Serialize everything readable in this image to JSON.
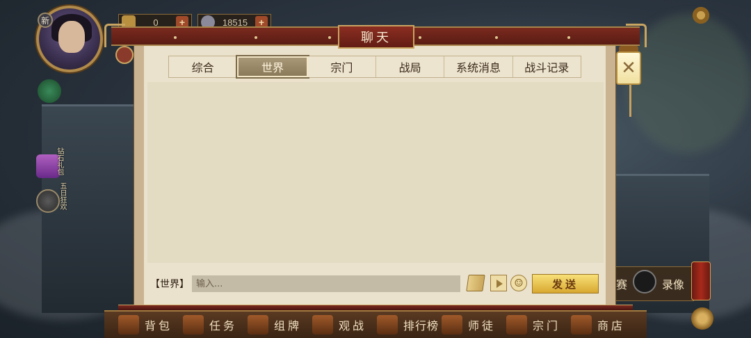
{
  "hud": {
    "avatar_badge": "新",
    "resource1_value": "0",
    "resource2_value": "18515",
    "plus": "+",
    "side1_label": "钻石礼包",
    "side2_label": "五日狂欢"
  },
  "chat": {
    "title": "聊天",
    "tabs": [
      {
        "label": "综合"
      },
      {
        "label": "世界"
      },
      {
        "label": "宗门"
      },
      {
        "label": "战局"
      },
      {
        "label": "系统消息"
      },
      {
        "label": "战斗记录"
      }
    ],
    "active_tab": "世界",
    "channel_label": "【世界】",
    "input_placeholder": "输入...",
    "input_value": "",
    "send_label": "发送",
    "close_glyph": "✕",
    "smile_glyph": "☺"
  },
  "bottom_nav": {
    "items": [
      {
        "label": "背包",
        "icon": "bag-icon"
      },
      {
        "label": "任务",
        "icon": "scroll-icon"
      },
      {
        "label": "组牌",
        "icon": "cards-icon"
      },
      {
        "label": "观战",
        "icon": "spectate-icon"
      },
      {
        "label": "排行榜",
        "icon": "ranking-icon"
      },
      {
        "label": "师徒",
        "icon": "mentor-icon"
      },
      {
        "label": "宗门",
        "icon": "sect-icon"
      },
      {
        "label": "商店",
        "icon": "shop-icon"
      }
    ],
    "right_extra1": "赛",
    "right_extra2": "录像"
  },
  "colors": {
    "panel_bg": "#ebe2cd",
    "title_red": "#7a2a1e",
    "gold": "#c9a562",
    "send_gold": "#f8e078"
  }
}
